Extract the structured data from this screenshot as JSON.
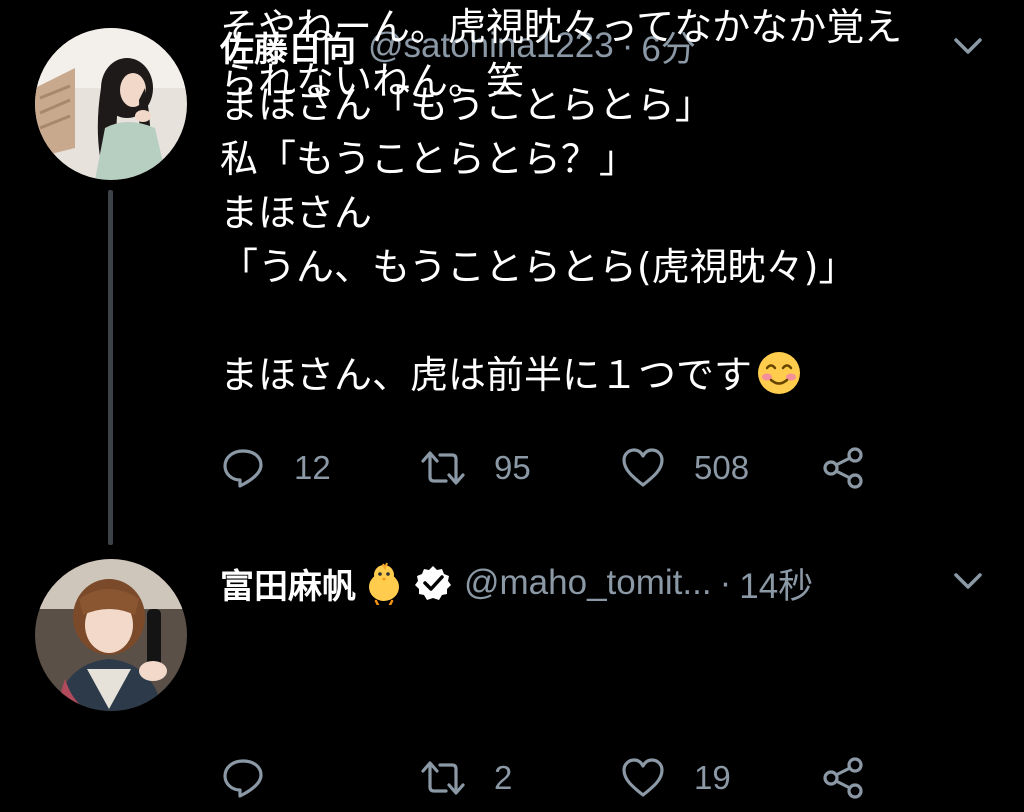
{
  "tweets": [
    {
      "display_name": "佐藤日向",
      "handle": "@satohina1223",
      "separator": "·",
      "time": "6分",
      "text_lines": [
        "まほさん「もうことらとら」",
        "私「もうことらとら？」",
        "まほさん",
        "「うん、もうことらとら(虎視眈々)」",
        "",
        "まほさん、虎は前半に１つです"
      ],
      "emoji": "smiling-face-emoji",
      "reply_count": "12",
      "retweet_count": "95",
      "like_count": "508"
    },
    {
      "display_name": "富田麻帆",
      "name_emoji": "chick-emoji",
      "verified": true,
      "handle": "@maho_tomit...",
      "separator": "·",
      "time": "14秒",
      "text_lines": [
        "そやねーん。虎視眈々ってなかなか覚え",
        "られないねん。笑"
      ],
      "reply_count": "",
      "retweet_count": "2",
      "like_count": "19"
    }
  ],
  "colors": {
    "background": "#000000",
    "text": "#ffffff",
    "secondary_text": "#8b98a5",
    "thread_line": "#3d4248"
  }
}
